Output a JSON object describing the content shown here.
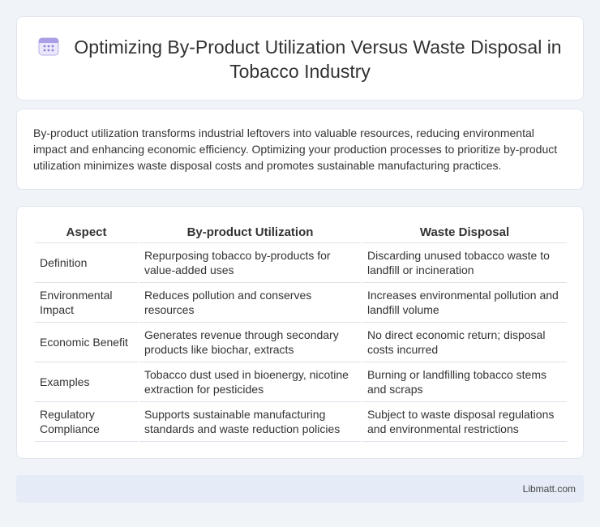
{
  "header": {
    "title": "Optimizing By-Product Utilization Versus Waste Disposal in Tobacco Industry",
    "icon": "calendar-icon"
  },
  "intro": {
    "text": "By-product utilization transforms industrial leftovers into valuable resources, reducing environmental impact and enhancing economic efficiency. Optimizing your production processes to prioritize by-product utilization minimizes waste disposal costs and promotes sustainable manufacturing practices."
  },
  "table": {
    "headers": [
      "Aspect",
      "By-product Utilization",
      "Waste Disposal"
    ],
    "rows": [
      [
        "Definition",
        "Repurposing tobacco by-products for value-added uses",
        "Discarding unused tobacco waste to landfill or incineration"
      ],
      [
        "Environmental Impact",
        "Reduces pollution and conserves resources",
        "Increases environmental pollution and landfill volume"
      ],
      [
        "Economic Benefit",
        "Generates revenue through secondary products like biochar, extracts",
        "No direct economic return; disposal costs incurred"
      ],
      [
        "Examples",
        "Tobacco dust used in bioenergy, nicotine extraction for pesticides",
        "Burning or landfilling tobacco stems and scraps"
      ],
      [
        "Regulatory Compliance",
        "Supports sustainable manufacturing standards and waste reduction policies",
        "Subject to waste disposal regulations and environmental restrictions"
      ]
    ]
  },
  "footer": {
    "text": "Libmatt.com"
  },
  "colors": {
    "background": "#f0f3f8",
    "card": "#ffffff",
    "footer": "#e5ecf7",
    "icon_accent": "#8a7fd6"
  }
}
